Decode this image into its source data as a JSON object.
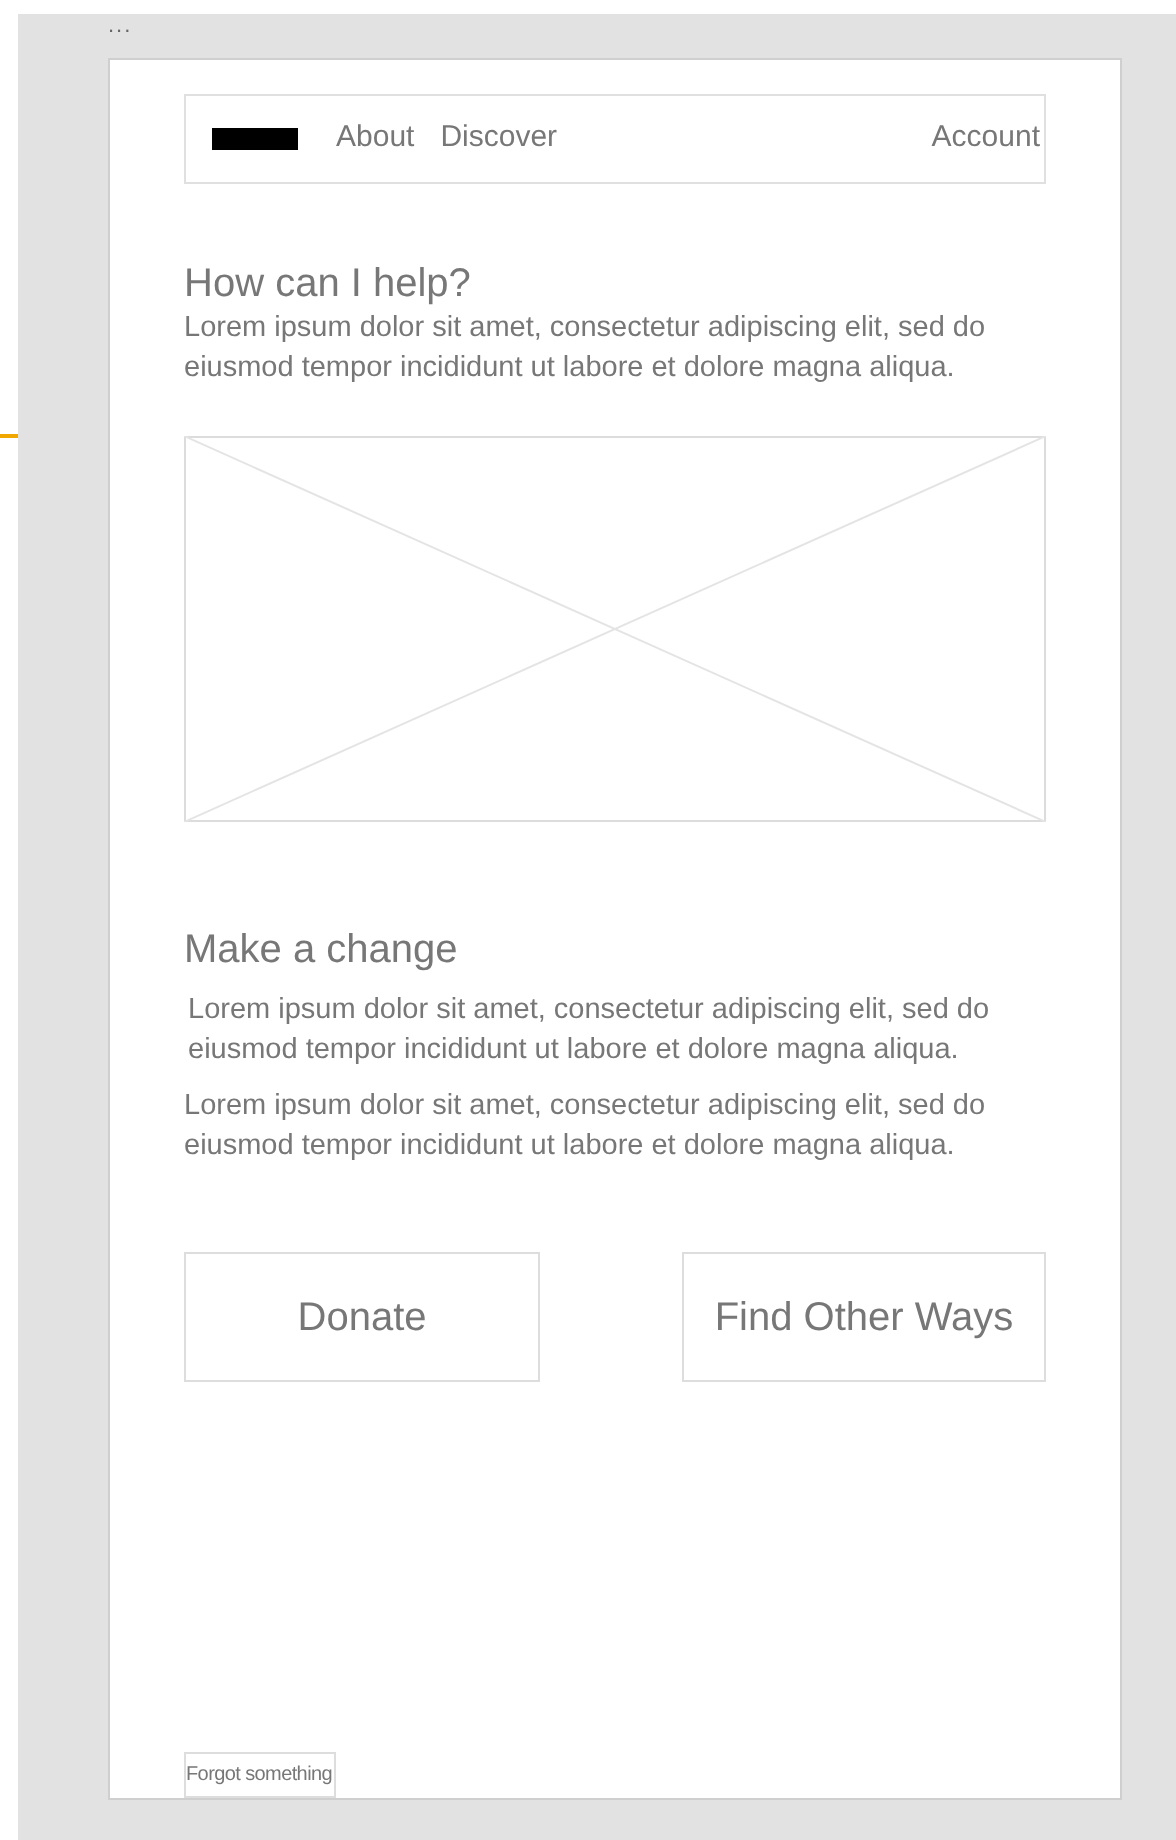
{
  "toolbar": {
    "menu": "..."
  },
  "nav": {
    "links": [
      "About",
      "Discover"
    ],
    "account": "Account"
  },
  "intro": {
    "heading": "How can I help?",
    "text": "Lorem ipsum dolor sit amet, consectetur adipiscing elit, sed do eiusmod tempor incididunt ut labore et dolore magna aliqua."
  },
  "section": {
    "heading": "Make a change",
    "paragraphs": [
      "Lorem ipsum dolor sit amet, consectetur adipiscing elit, sed do eiusmod tempor incididunt ut labore et dolore magna aliqua.",
      "Lorem ipsum dolor sit amet, consectetur adipiscing elit, sed do eiusmod tempor incididunt ut labore et dolore magna aliqua."
    ]
  },
  "buttons": [
    "Donate",
    "Find Other Ways"
  ],
  "footer_link": "Forgot something"
}
